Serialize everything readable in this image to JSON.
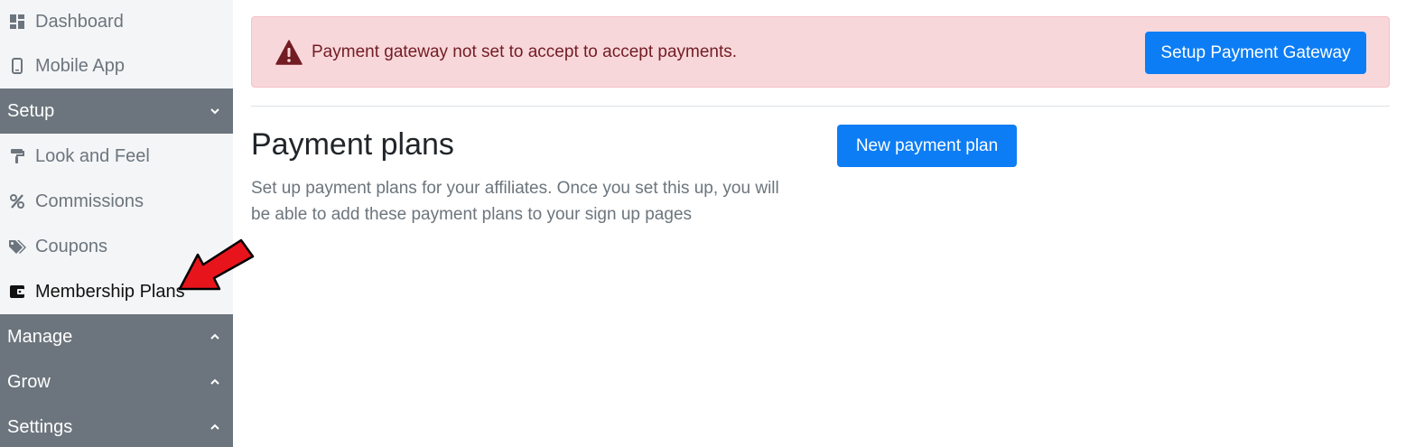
{
  "sidebar": {
    "top_items": [
      {
        "label": "Dashboard",
        "icon": "dashboard-icon"
      },
      {
        "label": "Mobile App",
        "icon": "mobile-phone-icon"
      }
    ],
    "setup_section": {
      "label": "Setup",
      "icon": "chevron-down-icon"
    },
    "setup_items": [
      {
        "label": "Look and Feel",
        "icon": "paint-roller-icon"
      },
      {
        "label": "Commissions",
        "icon": "percent-icon"
      },
      {
        "label": "Coupons",
        "icon": "tags-icon"
      },
      {
        "label": "Membership Plans",
        "icon": "wallet-icon",
        "active": true
      }
    ],
    "collapsed_sections": [
      {
        "label": "Manage",
        "icon": "chevron-up-icon"
      },
      {
        "label": "Grow",
        "icon": "chevron-up-icon"
      },
      {
        "label": "Settings",
        "icon": "chevron-up-icon"
      }
    ]
  },
  "alert": {
    "icon": "warning-triangle-icon",
    "message": "Payment gateway not set to accept to accept payments.",
    "button_label": "Setup Payment Gateway"
  },
  "main": {
    "title": "Payment plans",
    "description": "Set up payment plans for your affiliates. Once you set this up, you will be able to add these payment plans to your sign up pages",
    "new_button_label": "New payment plan"
  },
  "colors": {
    "sidebar_bg": "#f4f5f7",
    "section_header_bg": "#6c757d",
    "alert_bg": "#f8d7da",
    "alert_text": "#721c24",
    "primary": "#0d7df5",
    "annotation_arrow": "#e8141c"
  }
}
